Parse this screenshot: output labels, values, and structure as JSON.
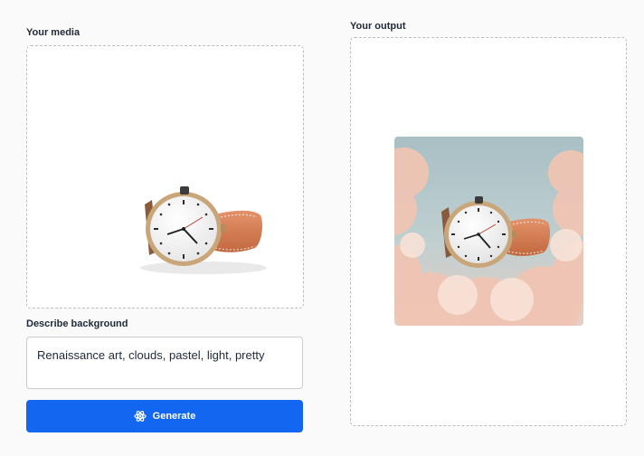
{
  "media": {
    "label": "Your media"
  },
  "background": {
    "label": "Describe background",
    "prompt_value": "Renaissance art, clouds, pastel, light, pretty"
  },
  "generate": {
    "label": "Generate"
  },
  "output": {
    "label": "Your output"
  },
  "icons": {
    "generate": "atom-icon"
  },
  "colors": {
    "accent": "#1366f0",
    "strap": "#d9805a",
    "case": "#c9a67a",
    "sky": "#a9c2c8",
    "cloud": "#f1c7b8"
  }
}
